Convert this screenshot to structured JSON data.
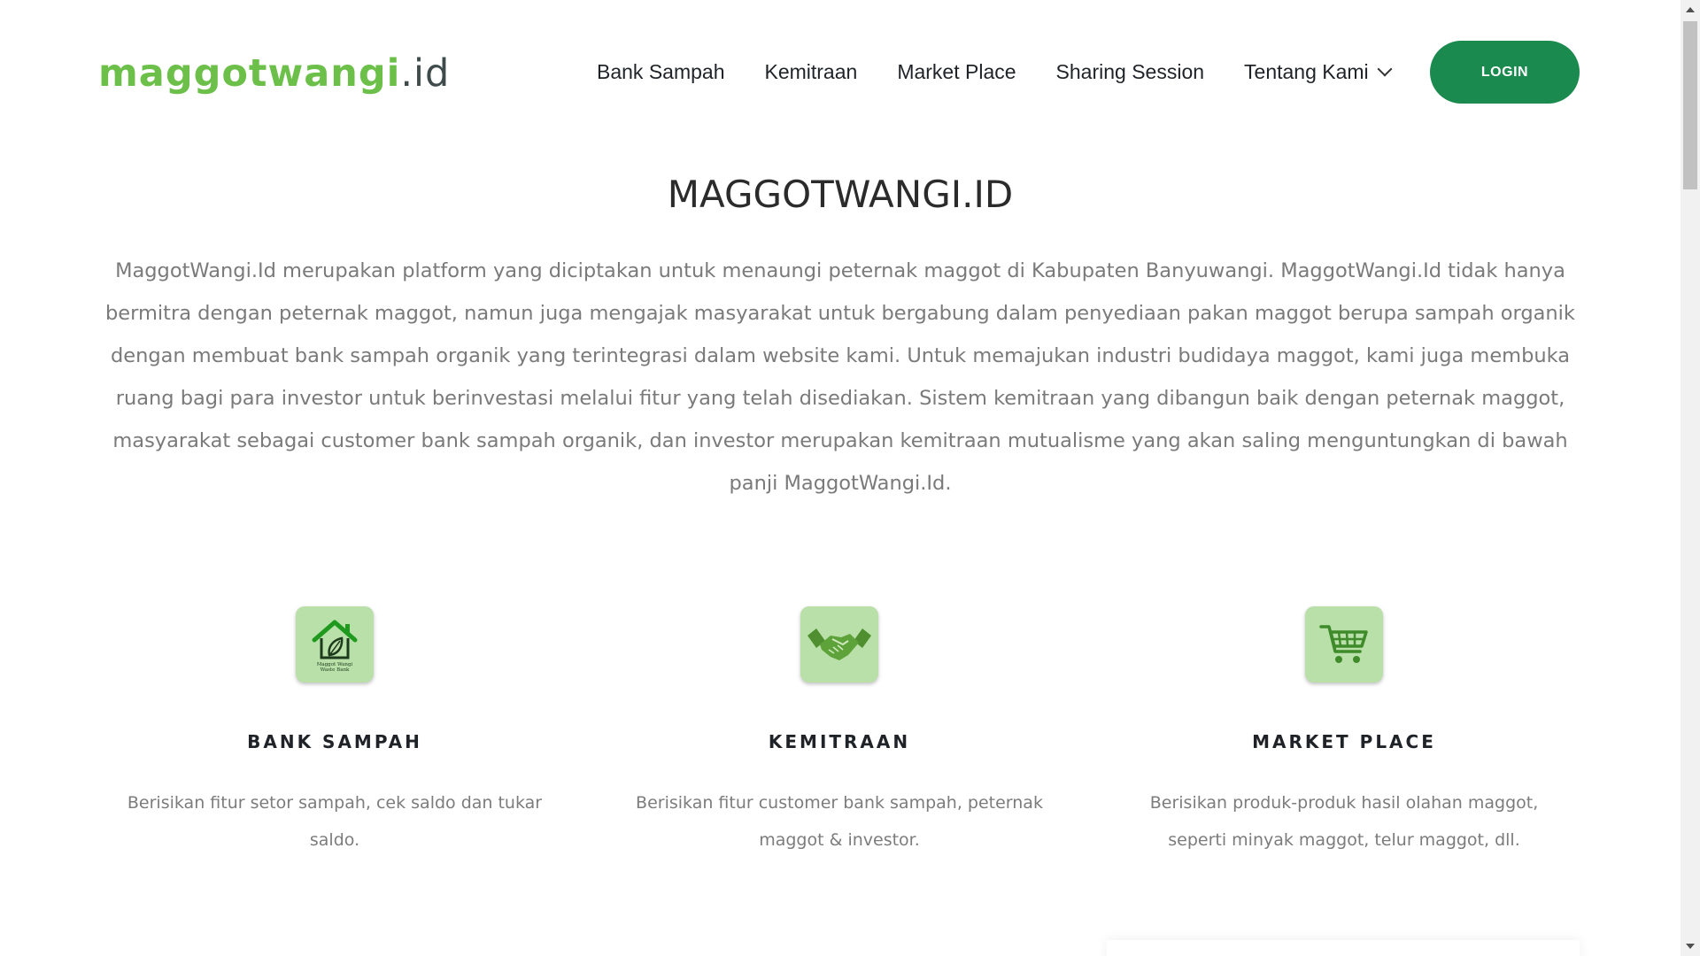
{
  "header": {
    "logo_main": "maggotwangi",
    "logo_tld": ".id",
    "nav": [
      {
        "label": "Bank Sampah"
      },
      {
        "label": "Kemitraan"
      },
      {
        "label": "Market Place"
      },
      {
        "label": "Sharing Session"
      },
      {
        "label": "Tentang Kami"
      }
    ],
    "login_label": "LOGIN"
  },
  "about": {
    "title": "MAGGOTWANGI.ID",
    "text": "MaggotWangi.Id merupakan platform yang diciptakan untuk menaungi peternak maggot di Kabupaten Banyuwangi. MaggotWangi.Id tidak hanya bermitra dengan peternak maggot, namun juga mengajak masyarakat untuk bergabung dalam penyediaan pakan maggot berupa sampah organik dengan membuat bank sampah organik yang terintegrasi dalam website kami. Untuk memajukan industri budidaya maggot, kami juga membuka ruang bagi para investor untuk berinvestasi melalui fitur yang telah disediakan. Sistem kemitraan yang dibangun baik dengan peternak maggot, masyarakat sebagai customer bank sampah organik, dan investor merupakan kemitraan mutualisme yang akan saling menguntungkan di bawah panji MaggotWangi.Id."
  },
  "features": [
    {
      "icon": "waste-bank-logo-icon",
      "icon_caption": "Maggot Wangi Waste Bank",
      "title": "BANK SAMPAH",
      "desc": "Berisikan fitur setor sampah, cek saldo dan tukar saldo."
    },
    {
      "icon": "handshake-icon",
      "title": "KEMITRAAN",
      "desc": "Berisikan fitur customer bank sampah, peternak maggot & investor."
    },
    {
      "icon": "shopping-cart-icon",
      "title": "MARKET PLACE",
      "desc": "Berisikan produk-produk hasil olahan maggot, seperti minyak maggot, telur maggot, dll."
    }
  ],
  "colors": {
    "brand_green": "#6cc04a",
    "button_green": "#1a8a4e",
    "icon_bg": "#b9e0a8",
    "icon_fg": "#2e9e2e"
  }
}
